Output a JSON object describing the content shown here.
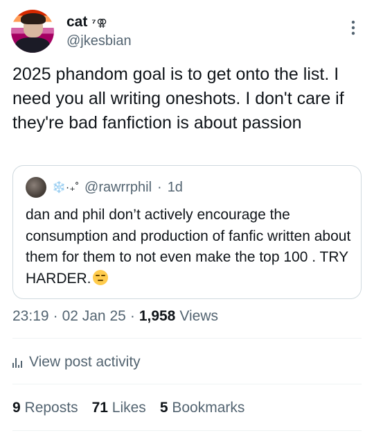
{
  "author": {
    "display_name": "cat",
    "name_badge": "⁷⚢",
    "handle": "@jkesbian"
  },
  "tweet": {
    "text": "2025 phandom goal is to get onto the list. I need you all writing oneshots. I don't care if they're bad fanfiction is about passion"
  },
  "quote": {
    "decoration": "❄️·₊˚",
    "handle": "@rawrrphil",
    "separator": "·",
    "time": "1d",
    "text": "dan and phil don’t actively encourage the consumption and production of fanfic written about them for them to not even make the top 100 . TRY HARDER.",
    "emoji": "unamused-face"
  },
  "meta": {
    "time": "23:19",
    "date": "02 Jan 25",
    "views_count": "1,958",
    "views_label": "Views",
    "separator": "·"
  },
  "activity": {
    "label": "View post activity",
    "icon": "bar-chart-icon"
  },
  "stats": {
    "reposts_count": "9",
    "reposts_label": "Reposts",
    "likes_count": "71",
    "likes_label": "Likes",
    "bookmarks_count": "5",
    "bookmarks_label": "Bookmarks"
  },
  "colors": {
    "text_primary": "#0f1419",
    "text_secondary": "#536471",
    "border": "#cfd9de",
    "avatar_flag": [
      "#d62900",
      "#ff9b55",
      "#ffffff",
      "#d461a6",
      "#a50062"
    ]
  }
}
